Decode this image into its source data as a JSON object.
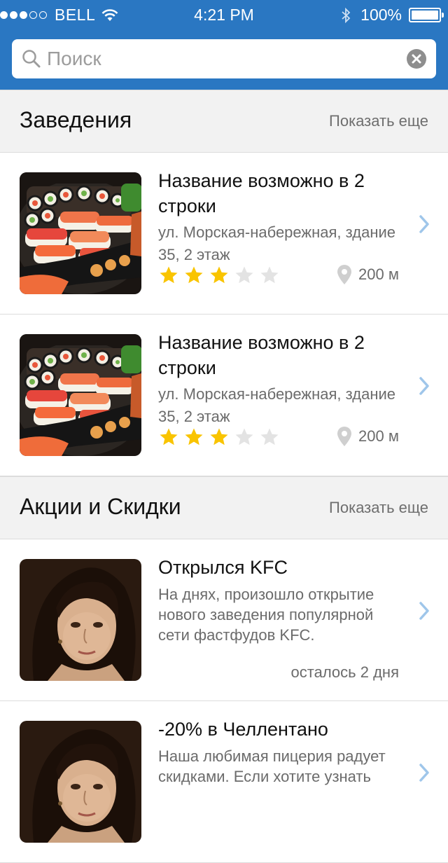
{
  "status": {
    "signal_filled": 3,
    "signal_total": 5,
    "carrier": "BELL",
    "time": "4:21 PM",
    "battery": "100%"
  },
  "search": {
    "placeholder": "Поиск"
  },
  "venues": {
    "title": "Заведения",
    "more": "Показать еще",
    "items": [
      {
        "name": "Название возможно в 2 строки",
        "address": "ул. Морская-набережная, здание 35, 2 этаж",
        "rating": 3,
        "rating_max": 5,
        "distance": "200 м",
        "image": "sushi-platter"
      },
      {
        "name": "Название возможно в 2 строки",
        "address": "ул. Морская-набережная, здание 35, 2 этаж",
        "rating": 3,
        "rating_max": 5,
        "distance": "200 м",
        "image": "sushi-platter"
      }
    ]
  },
  "promos": {
    "title": "Акции и Скидки",
    "more": "Показать еще",
    "items": [
      {
        "title": "Открылся KFC",
        "text": "На днях, произошло открытие нового заведения популярной сети фастфудов KFC.",
        "remaining": "осталось 2 дня",
        "image": "portrait-painting"
      },
      {
        "title": "-20% в Челлентано",
        "text": "Наша любимая пицерия радует скидками. Если хотите узнать",
        "image": "portrait-painting"
      }
    ]
  },
  "colors": {
    "header_blue": "#2a77c2",
    "star_filled": "#f9c400",
    "star_empty": "#e3e3e3",
    "chevron": "#9fc6ea"
  }
}
